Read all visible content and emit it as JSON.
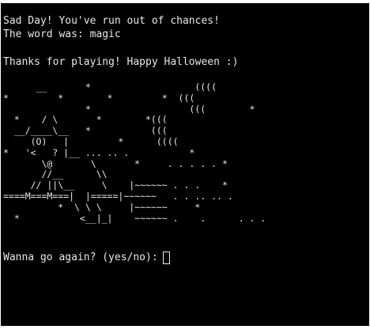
{
  "terminal": {
    "lose_message": "Sad Day! You've run out of chances!",
    "word_reveal": "The word was: magic",
    "thanks_message": "Thanks for playing! Happy Halloween :)",
    "ascii_art": "      __       *                   ((((\n*         *        *         *  (((\n               *                  (((        *\n  *    / \\       *        *(((\n  __/____\\__   *           (((\n     (O)   |         *      ((((\n*   '<   ? |__ ... .. .           *\n       \\@       \\       *     . . . . . *\n       //__      \\\\\n     // ||\\__     \\    |~~~~~~ . . .    *\n====M===M===|  |=====|~~~~~~   . . .. .. .\n          *  \\ \\ \\     |~~~~~~     *\n  *           <__|_|    ~~~~~~ .    .      . . .",
    "prompt": "Wanna go again? (yes/no):",
    "input_value": ""
  }
}
